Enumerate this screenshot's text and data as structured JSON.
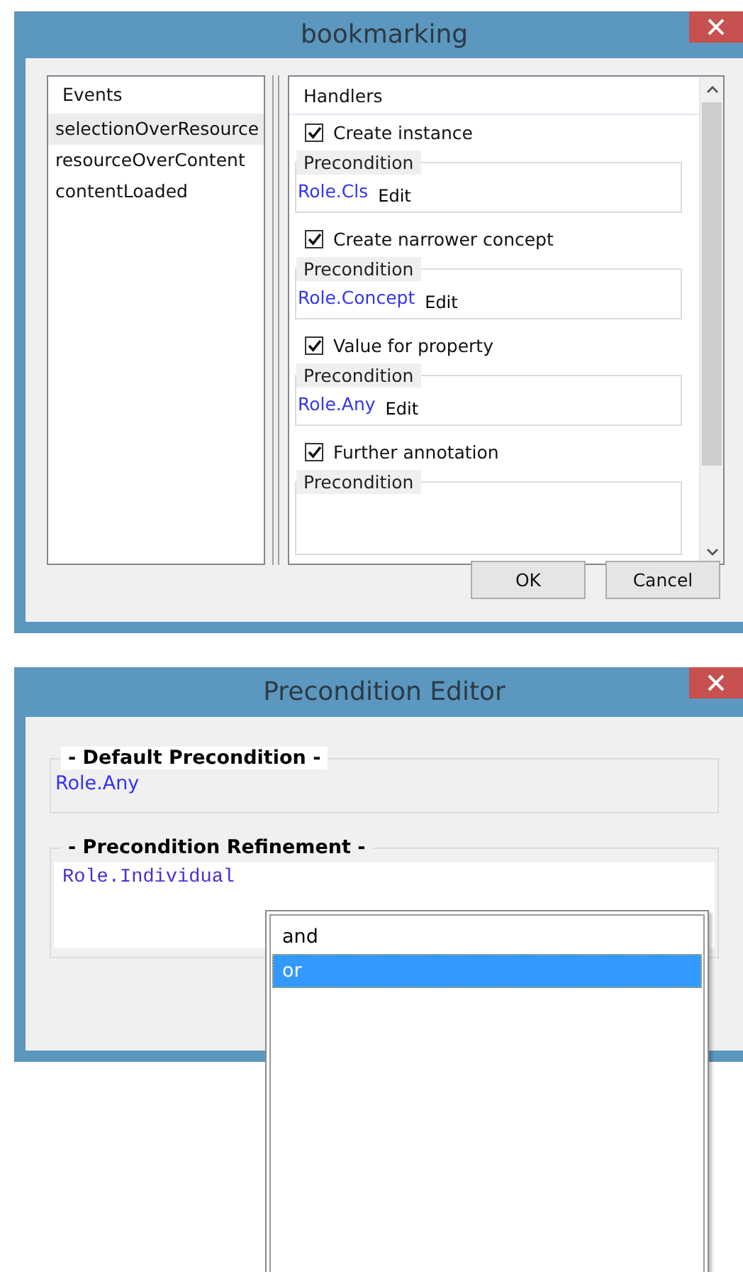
{
  "main_dialog": {
    "title": "bookmarking",
    "events": {
      "header": "Events",
      "items": [
        {
          "label": "selectionOverResource",
          "selected": true
        },
        {
          "label": "resourceOverContent",
          "selected": false
        },
        {
          "label": "contentLoaded",
          "selected": false
        }
      ]
    },
    "handlers": {
      "header": "Handlers",
      "items": [
        {
          "label": "Create instance",
          "checked": true,
          "precondition": {
            "label": "Precondition",
            "role": "Role.Cls",
            "edit": "Edit"
          }
        },
        {
          "label": "Create narrower concept",
          "checked": true,
          "precondition": {
            "label": "Precondition",
            "role": "Role.Concept",
            "edit": "Edit"
          }
        },
        {
          "label": "Value for property",
          "checked": true,
          "precondition": {
            "label": "Precondition",
            "role": "Role.Any",
            "edit": "Edit"
          }
        },
        {
          "label": "Further annotation",
          "checked": true,
          "precondition": {
            "label": "Precondition"
          }
        }
      ]
    },
    "buttons": [
      "OK",
      "Cancel"
    ]
  },
  "precondition_editor": {
    "title": "Precondition Editor",
    "default_precondition": {
      "legend": "- Default Precondition -",
      "value": "Role.Any"
    },
    "refinement": {
      "legend": "- Precondition Refinement -",
      "value": "Role.Individual"
    },
    "completion_popup": {
      "items": [
        {
          "label": "and",
          "selected": false
        },
        {
          "label": "or",
          "selected": true
        }
      ]
    }
  }
}
